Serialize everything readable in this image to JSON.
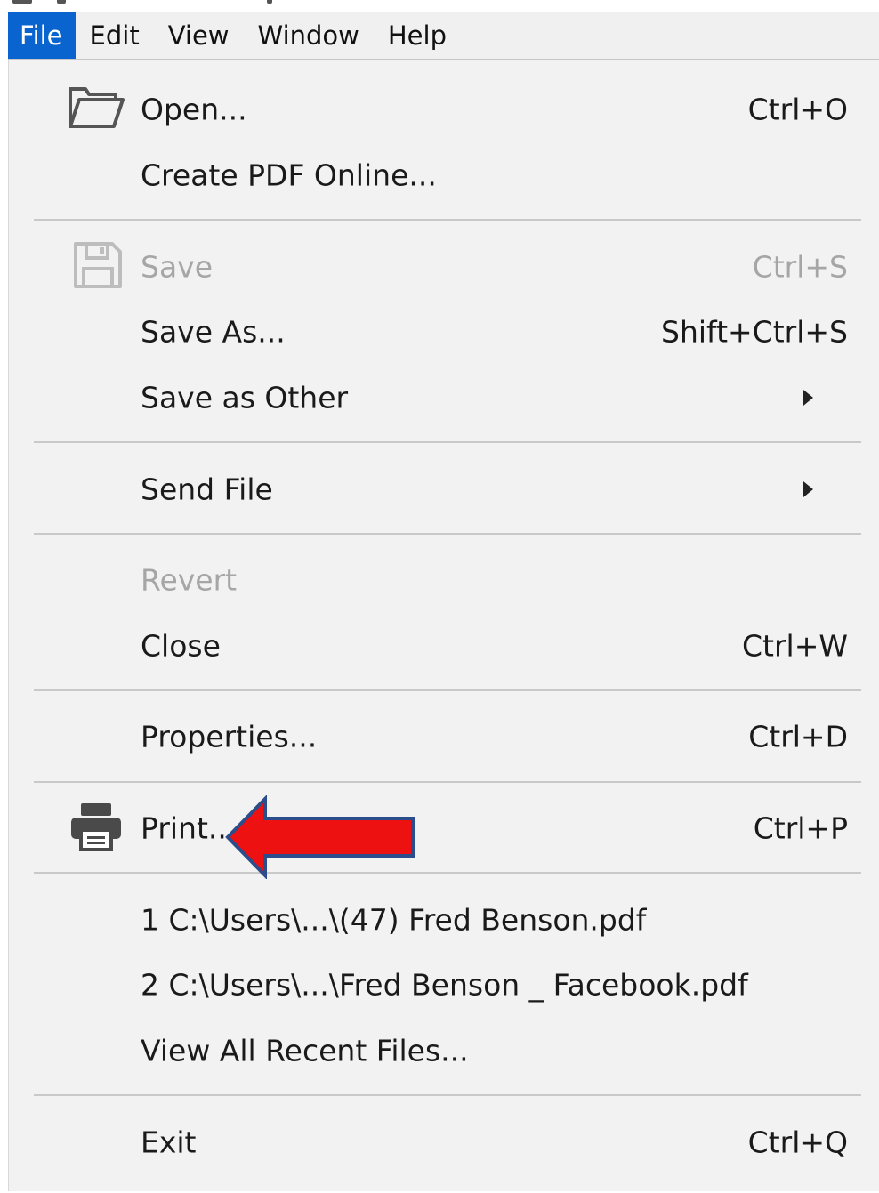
{
  "menubar": {
    "items": [
      {
        "label": "File",
        "active": true
      },
      {
        "label": "Edit"
      },
      {
        "label": "View"
      },
      {
        "label": "Window"
      },
      {
        "label": "Help"
      }
    ]
  },
  "file_menu": {
    "open": {
      "label": "Open...",
      "shortcut": "Ctrl+O",
      "icon": "folder-open-icon"
    },
    "create_pdf_online": {
      "label": "Create PDF Online..."
    },
    "save": {
      "label": "Save",
      "shortcut": "Ctrl+S",
      "icon": "floppy-disk-icon",
      "disabled": true
    },
    "save_as": {
      "label": "Save As...",
      "shortcut": "Shift+Ctrl+S"
    },
    "save_as_other": {
      "label": "Save as Other",
      "submenu": true
    },
    "send_file": {
      "label": "Send File",
      "submenu": true
    },
    "revert": {
      "label": "Revert",
      "disabled": true
    },
    "close": {
      "label": "Close",
      "shortcut": "Ctrl+W"
    },
    "properties": {
      "label": "Properties...",
      "shortcut": "Ctrl+D"
    },
    "print": {
      "label": "Print...",
      "shortcut": "Ctrl+P",
      "icon": "printer-icon"
    },
    "recent_1": {
      "label": "1 C:\\Users\\...\\(47) Fred Benson.pdf"
    },
    "recent_2": {
      "label": "2 C:\\Users\\...\\Fred Benson _ Facebook.pdf"
    },
    "view_all_recent": {
      "label": "View All Recent Files..."
    },
    "exit": {
      "label": "Exit",
      "shortcut": "Ctrl+Q"
    }
  },
  "annotation": {
    "type": "red-arrow-pointing-left",
    "target": "print",
    "fill": "#ee1111",
    "outline": "#2b4d8c"
  },
  "colors": {
    "menubar_active_bg": "#0a64d0",
    "menu_bg": "#f2f2f2",
    "disabled_text": "#a6a6a6",
    "separator": "#c9c9c9"
  }
}
